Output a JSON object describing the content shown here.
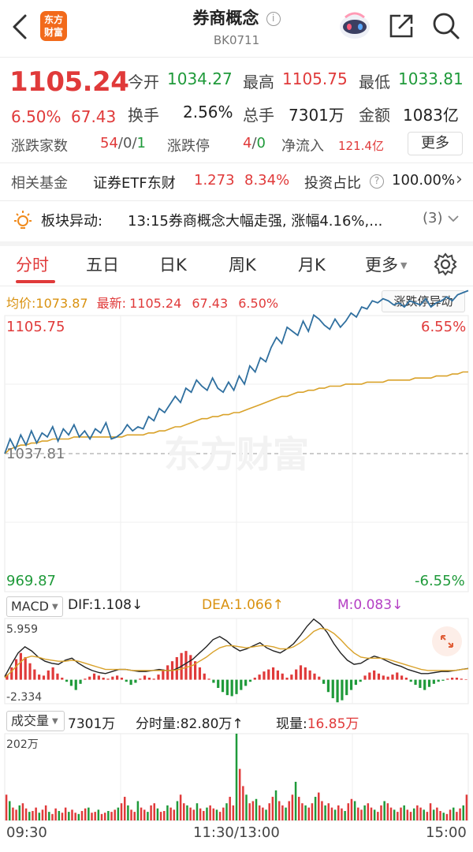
{
  "header": {
    "logo_line1": "东方",
    "logo_line2": "财富",
    "title": "券商概念",
    "info_glyph": "i",
    "code": "BK0711"
  },
  "quote": {
    "price": "1105.24",
    "change": "6.50%",
    "change_abs": "67.43",
    "open_label": "今开",
    "open": "1034.27",
    "high_label": "最高",
    "high": "1105.75",
    "low_label": "最低",
    "low": "1033.81",
    "turnover_label": "换手",
    "turnover": "2.56%",
    "volume_label": "总手",
    "volume": "7301万",
    "amount_label": "金额",
    "amount": "1083亿",
    "adv_label": "涨跌家数",
    "adv_up": "54",
    "adv_sep1": "/",
    "adv_flat": "0",
    "adv_sep2": "/",
    "adv_down": "1",
    "limit_label": "涨跌停",
    "limit_up": "4",
    "limit_sep": "/",
    "limit_down": "0",
    "inflow_label": "净流入",
    "inflow": "121.4亿",
    "more_label": "更多"
  },
  "fund": {
    "label": "相关基金",
    "name": "证券ETF东财",
    "price": "1.273",
    "pct": "8.34%",
    "ratio_label": "投资占比",
    "ratio_help": "?",
    "ratio": "100.00%",
    "chevron": "›"
  },
  "alert": {
    "label": "板块异动:",
    "text": "13:15券商概念大幅走强, 涨幅4.16%,...",
    "count": "(3)"
  },
  "tabs": [
    {
      "label": "分时"
    },
    {
      "label": "五日"
    },
    {
      "label": "日K"
    },
    {
      "label": "周K"
    },
    {
      "label": "月K"
    },
    {
      "label": "更多"
    }
  ],
  "chart_info": {
    "avg_label": "均价:",
    "avg": "1073.87",
    "latest_label": "最新:",
    "latest": "1105.24",
    "latest_chg": "67.43",
    "latest_pct": "6.50%",
    "limit_button": "涨跌停异动"
  },
  "price_axis": {
    "top": "1105.75",
    "top_pct": "6.55%",
    "mid": "1037.81",
    "bottom": "969.87",
    "bottom_pct": "-6.55%",
    "watermark": "东方财富"
  },
  "macd": {
    "selector": "MACD",
    "dif_label": "DIF:1.108",
    "dif_arrow": "↓",
    "dea_label": "DEA:1.066",
    "dea_arrow": "↑",
    "m_label": "M:0.083",
    "m_arrow": "↓",
    "top": "5.959",
    "bottom": "-2.334"
  },
  "volume": {
    "selector": "成交量",
    "total": "7301万",
    "period_label": "分时量:82.80万",
    "period_arrow": "↑",
    "now_label": "现量:",
    "now": "16.85万",
    "top": "202万"
  },
  "time_axis": {
    "start": "09:30",
    "mid": "11:30/13:00",
    "end": "15:00"
  },
  "colors": {
    "up": "#e03a3a",
    "down": "#1f9a3a",
    "price_line": "#2f6f9f",
    "avg_line": "#d9a22a",
    "accent": "#f26a1b"
  },
  "chart_data": [
    {
      "type": "line",
      "x_range": [
        "09:30",
        "15:00"
      ],
      "ylim": [
        969.87,
        1105.75
      ],
      "reference": 1037.81,
      "series": [
        {
          "name": "最新",
          "values": [
            1037.8,
            1045,
            1040,
            1047,
            1042,
            1049,
            1043,
            1048,
            1046,
            1051,
            1044,
            1050,
            1047,
            1052,
            1046,
            1049,
            1045,
            1050,
            1048,
            1053,
            1045,
            1046,
            1048,
            1052,
            1049,
            1051,
            1050,
            1056,
            1054,
            1060,
            1058,
            1062,
            1066,
            1063,
            1070,
            1068,
            1074,
            1071,
            1069,
            1075,
            1070,
            1068,
            1073,
            1069,
            1076,
            1072,
            1081,
            1078,
            1085,
            1083,
            1090,
            1095,
            1092,
            1100,
            1098,
            1096,
            1103,
            1098,
            1106,
            1104,
            1101,
            1099,
            1104,
            1100,
            1103,
            1107,
            1105,
            1110,
            1109,
            1113,
            1112,
            1114,
            1113,
            1111,
            1112,
            1110,
            1113,
            1112,
            1111,
            1114,
            1110,
            1112,
            1113,
            1115,
            1113,
            1116,
            1117,
            1118
          ]
        },
        {
          "name": "均价",
          "values": [
            1037.8,
            1040,
            1041,
            1042,
            1042,
            1043,
            1043,
            1044,
            1044,
            1045,
            1045,
            1045,
            1045,
            1046,
            1046,
            1046,
            1046,
            1046,
            1046,
            1046,
            1046,
            1046,
            1046,
            1047,
            1047,
            1047,
            1047,
            1048,
            1048,
            1049,
            1049,
            1050,
            1051,
            1051,
            1052,
            1053,
            1054,
            1055,
            1055,
            1056,
            1056,
            1057,
            1057,
            1058,
            1058,
            1059,
            1060,
            1061,
            1062,
            1063,
            1064,
            1065,
            1066,
            1066,
            1067,
            1068,
            1068,
            1069,
            1069,
            1070,
            1070,
            1071,
            1071,
            1071,
            1072,
            1072,
            1072,
            1072,
            1073,
            1073,
            1073,
            1073,
            1074,
            1074,
            1074,
            1074,
            1074,
            1075,
            1075,
            1075,
            1075,
            1076,
            1076,
            1076,
            1077,
            1077,
            1078,
            1078
          ]
        }
      ]
    },
    {
      "type": "bar",
      "ylim": [
        -2.334,
        5.959
      ],
      "series": [
        {
          "name": "M",
          "values": [
            0.5,
            1.2,
            2.0,
            2.6,
            2.2,
            1.6,
            1.0,
            0.5,
            0.4,
            0.9,
            1.2,
            0.6,
            0.2,
            -0.2,
            -0.6,
            -1.0,
            -0.4,
            0.1,
            0.3,
            0.6,
            0.4,
            0.2,
            0.1,
            0.3,
            0.4,
            0.2,
            -0.2,
            -0.5,
            -0.3,
            0.1,
            0.4,
            0.2,
            0.1,
            0.5,
            1.0,
            1.4,
            1.8,
            2.2,
            2.6,
            2.8,
            2.4,
            1.8,
            1.2,
            0.6,
            0.1,
            -0.3,
            -0.8,
            -1.2,
            -1.5,
            -1.6,
            -1.4,
            -1.0,
            -0.6,
            -0.2,
            0.2,
            0.5,
            0.8,
            1.0,
            1.2,
            0.9,
            0.6,
            0.2,
            0.5,
            1.0,
            1.4,
            1.2,
            0.9,
            0.6,
            0.3,
            -0.4,
            -1.2,
            -1.8,
            -2.2,
            -2.0,
            -1.5,
            -1.0,
            -0.5,
            -0.2,
            0.4,
            0.7,
            0.9,
            0.6,
            0.4,
            0.3,
            0.5,
            0.7,
            0.4,
            0.2,
            -0.2,
            -0.5,
            -0.8,
            -1.0,
            -0.7,
            -0.4,
            -0.2,
            -0.1,
            0.1,
            0.2,
            0.2,
            0.1,
            0.05
          ]
        },
        {
          "name": "DIF",
          "values": [
            0.3,
            1.5,
            2.6,
            3.2,
            2.8,
            2.2,
            1.8,
            1.6,
            1.5,
            1.9,
            2.1,
            1.6,
            1.2,
            0.9,
            0.7,
            0.6,
            0.8,
            1.0,
            1.0,
            0.9,
            0.8,
            0.8,
            0.9,
            1.0,
            0.9,
            0.9,
            1.2,
            1.6,
            2.0,
            2.6,
            3.2,
            3.9,
            4.2,
            3.8,
            3.2,
            2.8,
            3.0,
            3.3,
            3.6,
            3.1,
            2.8,
            2.6,
            3.0,
            3.5,
            4.3,
            5.2,
            5.9,
            5.4,
            4.6,
            3.5,
            2.6,
            1.9,
            1.5,
            1.6,
            2.0,
            2.3,
            2.1,
            1.8,
            1.5,
            1.3,
            1.0,
            0.8,
            0.6,
            0.6,
            0.7,
            0.8,
            0.8,
            0.9,
            1.0,
            1.1
          ]
        },
        {
          "name": "DEA",
          "values": [
            0.2,
            0.8,
            1.5,
            2.1,
            2.3,
            2.2,
            2.0,
            1.9,
            1.8,
            1.8,
            1.9,
            1.8,
            1.6,
            1.4,
            1.2,
            1.0,
            1.0,
            1.0,
            1.0,
            0.9,
            0.9,
            0.9,
            0.9,
            0.9,
            0.9,
            0.9,
            1.0,
            1.2,
            1.4,
            1.8,
            2.2,
            2.7,
            3.1,
            3.3,
            3.3,
            3.2,
            3.1,
            3.2,
            3.3,
            3.3,
            3.2,
            3.0,
            3.0,
            3.2,
            3.6,
            4.1,
            4.7,
            5.0,
            4.9,
            4.5,
            3.9,
            3.2,
            2.6,
            2.2,
            2.1,
            2.1,
            2.1,
            2.0,
            1.8,
            1.6,
            1.4,
            1.2,
            1.0,
            0.9,
            0.9,
            0.9,
            0.9,
            0.9,
            1.0,
            1.07
          ]
        }
      ]
    },
    {
      "type": "bar",
      "ylim": [
        0,
        202
      ],
      "series": [
        {
          "name": "成交量",
          "values": [
            60,
            45,
            30,
            25,
            35,
            40,
            28,
            20,
            22,
            30,
            18,
            25,
            35,
            20,
            15,
            28,
            22,
            18,
            30,
            20,
            25,
            18,
            15,
            22,
            28,
            30,
            18,
            20,
            25,
            15,
            18,
            22,
            20,
            25,
            30,
            40,
            55,
            35,
            25,
            20,
            45,
            30,
            25,
            20,
            35,
            40,
            28,
            20,
            22,
            35,
            30,
            25,
            45,
            60,
            40,
            35,
            30,
            25,
            40,
            28,
            22,
            30,
            35,
            28,
            25,
            20,
            30,
            40,
            55,
            35,
            202,
            120,
            80,
            60,
            40,
            45,
            50,
            35,
            30,
            25,
            40,
            55,
            70,
            45,
            35,
            30,
            45,
            60,
            90,
            55,
            40,
            35,
            30,
            40,
            55,
            65,
            45,
            35,
            40,
            30,
            25,
            35,
            28,
            22,
            40,
            50,
            45,
            30,
            25,
            35,
            40,
            30,
            25,
            20,
            35,
            45,
            40,
            30,
            25,
            20,
            30,
            35,
            25,
            20,
            28,
            35,
            30,
            25,
            20,
            40,
            25,
            30,
            22,
            18,
            15,
            25,
            30,
            20,
            28,
            35,
            60
          ]
        }
      ]
    }
  ]
}
